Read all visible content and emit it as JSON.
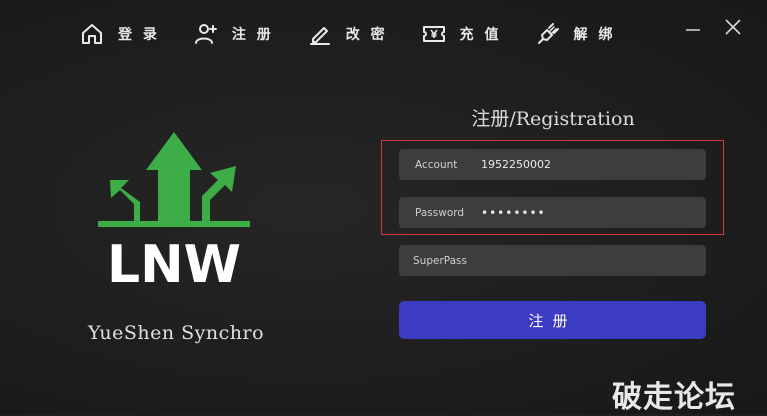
{
  "nav": {
    "items": [
      {
        "label": "登 录",
        "icon": "home-icon"
      },
      {
        "label": "注 册",
        "icon": "add-user-icon"
      },
      {
        "label": "改 密",
        "icon": "pen-icon"
      },
      {
        "label": "充 值",
        "icon": "yen-ticket-icon"
      },
      {
        "label": "解 绑",
        "icon": "unplug-icon"
      }
    ]
  },
  "window_controls": {
    "minimize_icon": "minimize-icon",
    "close_icon": "close-icon"
  },
  "logo": {
    "text": "LNW",
    "arrow_color": "#3dae47",
    "icon": "growth-arrows-icon"
  },
  "brand": {
    "name": "YueShen Synchro"
  },
  "form": {
    "title": "注册/Registration",
    "account": {
      "label": "Account",
      "value": "1952250002"
    },
    "password": {
      "label": "Password",
      "value": "••••••••"
    },
    "superpass": {
      "placeholder": "SuperPass"
    },
    "submit_label": "注册"
  },
  "watermark": {
    "text": "破走论坛"
  },
  "colors": {
    "accent": "#3b3bc4",
    "highlight": "#d03a3a",
    "field_bg": "#3d3d3d"
  }
}
